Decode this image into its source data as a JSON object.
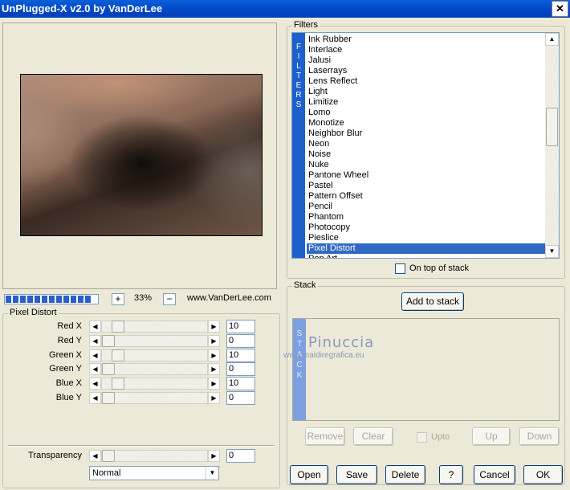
{
  "window": {
    "title": "UnPlugged-X v2.0 by VanDerLee",
    "close_glyph": "✕"
  },
  "progress": {
    "segments": 12,
    "fraction": 1.0
  },
  "zoom": {
    "plus": "+",
    "minus": "−",
    "value": "33%"
  },
  "website": "www.VanDerLee.com",
  "pixel_distort": {
    "title": "Pixel Distort",
    "sliders": [
      {
        "label": "Red X",
        "value": "10",
        "level": 0.1
      },
      {
        "label": "Red Y",
        "value": "0",
        "level": 0.0
      },
      {
        "label": "Green X",
        "value": "10",
        "level": 0.1
      },
      {
        "label": "Green Y",
        "value": "0",
        "level": 0.0
      },
      {
        "label": "Blue X",
        "value": "10",
        "level": 0.1
      },
      {
        "label": "Blue Y",
        "value": "0",
        "level": 0.0
      }
    ]
  },
  "transparency": {
    "label": "Transparency",
    "value": "0",
    "level": 0.0
  },
  "blend_mode": {
    "value": "Normal"
  },
  "filters": {
    "title": "Filters",
    "strip_text": [
      "F",
      "I",
      "L",
      "T",
      "E",
      "R",
      "S"
    ],
    "items": [
      "Ink Rubber",
      "Interlace",
      "Jalusi",
      "Laserrays",
      "Lens Reflect",
      "Light",
      "Limitize",
      "Lomo",
      "Monotize",
      "Neighbor Blur",
      "Neon",
      "Noise",
      "Nuke",
      "Pantone Wheel",
      "Pastel",
      "Pattern Offset",
      "Pencil",
      "Phantom",
      "Photocopy",
      "Pieslice",
      "Pixel Distort",
      "Pop Art"
    ],
    "selected": "Pixel Distort",
    "on_top_label": "On top of stack"
  },
  "stack": {
    "title": "Stack",
    "add_label": "Add to stack",
    "strip_text": [
      "S",
      "T",
      "A",
      "C",
      "K"
    ],
    "watermark": "Pinuccia",
    "watermark_url": "www.maidiregrafica.eu",
    "remove_label": "Remove",
    "clear_label": "Clear",
    "upto_label": "Upto",
    "up_label": "Up",
    "down_label": "Down"
  },
  "footer": {
    "open": "Open",
    "save": "Save",
    "delete": "Delete",
    "help": "?",
    "cancel": "Cancel",
    "ok": "OK"
  }
}
